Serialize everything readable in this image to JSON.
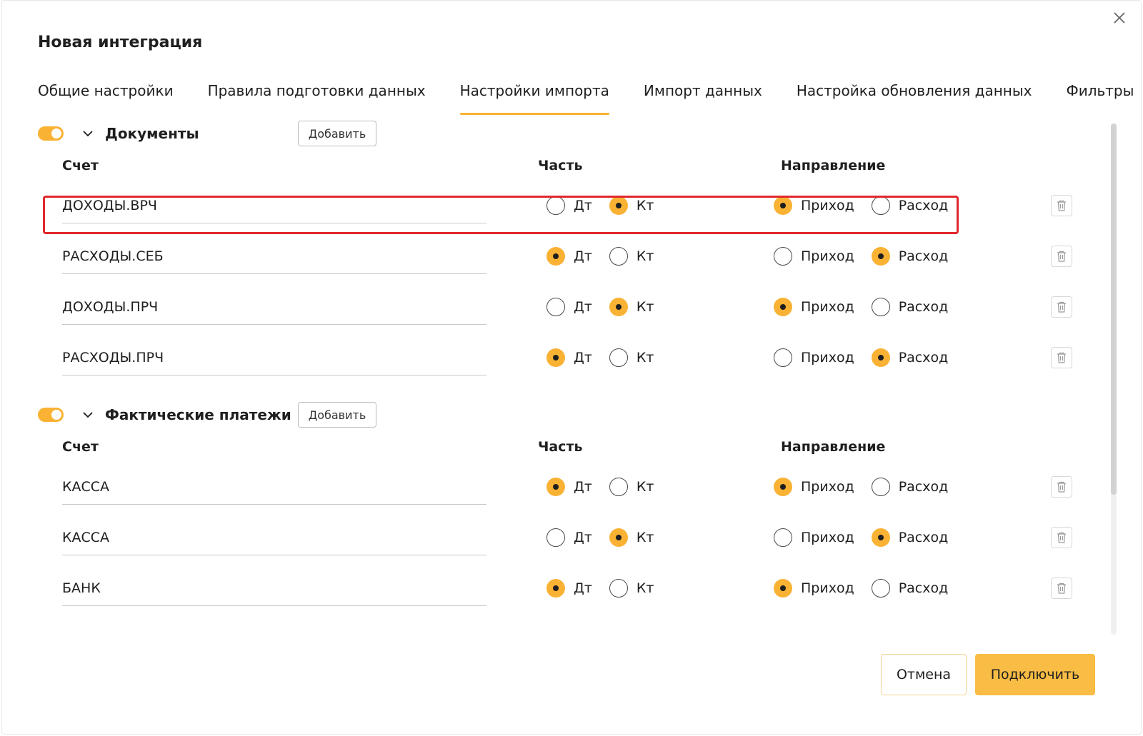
{
  "dialog": {
    "title": "Новая интеграция",
    "close_icon": "close-icon"
  },
  "tabs": [
    {
      "label": "Общие настройки",
      "active": false
    },
    {
      "label": "Правила подготовки данных",
      "active": false
    },
    {
      "label": "Настройки импорта",
      "active": true
    },
    {
      "label": "Импорт данных",
      "active": false
    },
    {
      "label": "Настройка обновления данных",
      "active": false
    },
    {
      "label": "Фильтры",
      "active": false
    }
  ],
  "columns": {
    "account": "Счет",
    "part": "Часть",
    "direction": "Направление"
  },
  "labels": {
    "debit": "Дт",
    "credit": "Кт",
    "income": "Приход",
    "expense": "Расход"
  },
  "sections": [
    {
      "name": "Документы",
      "enabled": true,
      "add_label": "Добавить",
      "rows": [
        {
          "account": "ДОХОДЫ.ВРЧ",
          "part": "credit",
          "direction": "income"
        },
        {
          "account": "РАСХОДЫ.СЕБ",
          "part": "debit",
          "direction": "expense"
        },
        {
          "account": "ДОХОДЫ.ПРЧ",
          "part": "credit",
          "direction": "income"
        },
        {
          "account": "РАСХОДЫ.ПРЧ",
          "part": "debit",
          "direction": "expense"
        }
      ]
    },
    {
      "name": "Фактические платежи",
      "enabled": true,
      "add_label": "Добавить",
      "rows": [
        {
          "account": "КАССА",
          "part": "debit",
          "direction": "income"
        },
        {
          "account": "КАССА",
          "part": "credit",
          "direction": "expense"
        },
        {
          "account": "БАНК",
          "part": "debit",
          "direction": "income"
        }
      ]
    }
  ],
  "footer": {
    "cancel_label": "Отмена",
    "connect_label": "Подключить"
  },
  "colors": {
    "accent": "#f9b233",
    "highlight": "#e0282d"
  }
}
